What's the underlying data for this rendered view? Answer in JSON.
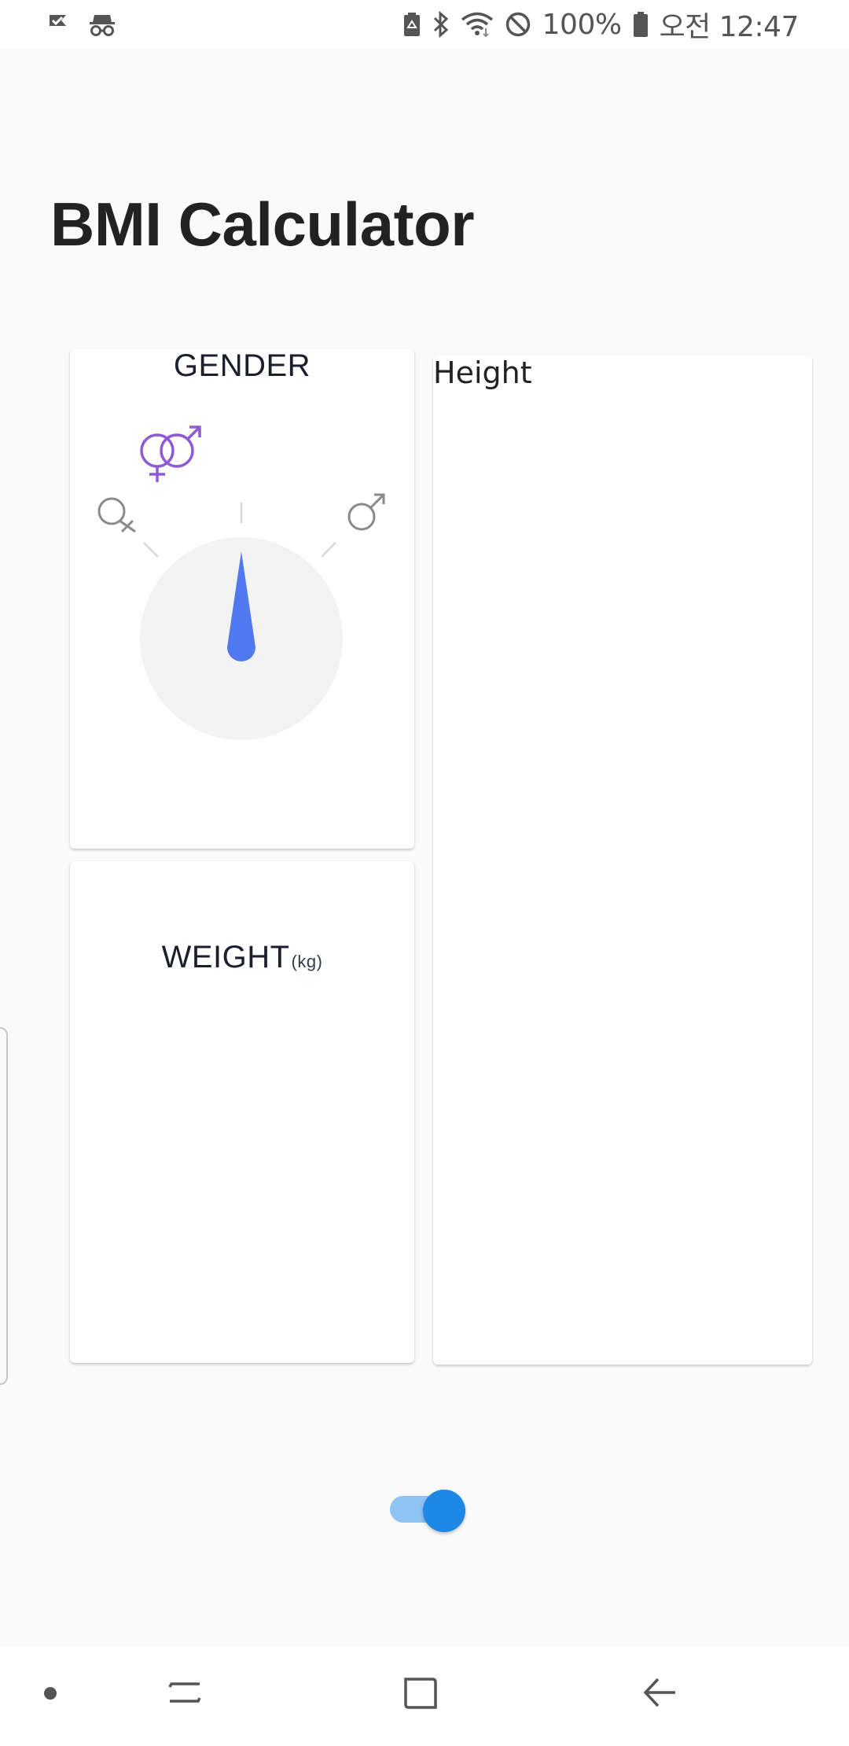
{
  "status_bar": {
    "battery_percent": "100%",
    "time": "오전 12:47",
    "icons": [
      "check-flag-icon",
      "incognito-icon",
      "battery-saver-icon",
      "bluetooth-icon",
      "wifi-icon",
      "do-not-disturb-icon",
      "battery-icon"
    ]
  },
  "app": {
    "title": "BMI Calculator"
  },
  "gender": {
    "title": "GENDER",
    "options": [
      "female-icon",
      "intersex-icon",
      "male-icon"
    ],
    "accent_color": "#8e5ad6",
    "pointer_color": "#5079f0"
  },
  "weight": {
    "title": "WEIGHT",
    "unit": "(kg)"
  },
  "height": {
    "label": "Height"
  },
  "toggle": {
    "on": true,
    "color": "#1e88e5"
  },
  "nav_bar": {
    "buttons": [
      "dot-icon",
      "recents-icon",
      "home-icon",
      "back-icon"
    ]
  }
}
